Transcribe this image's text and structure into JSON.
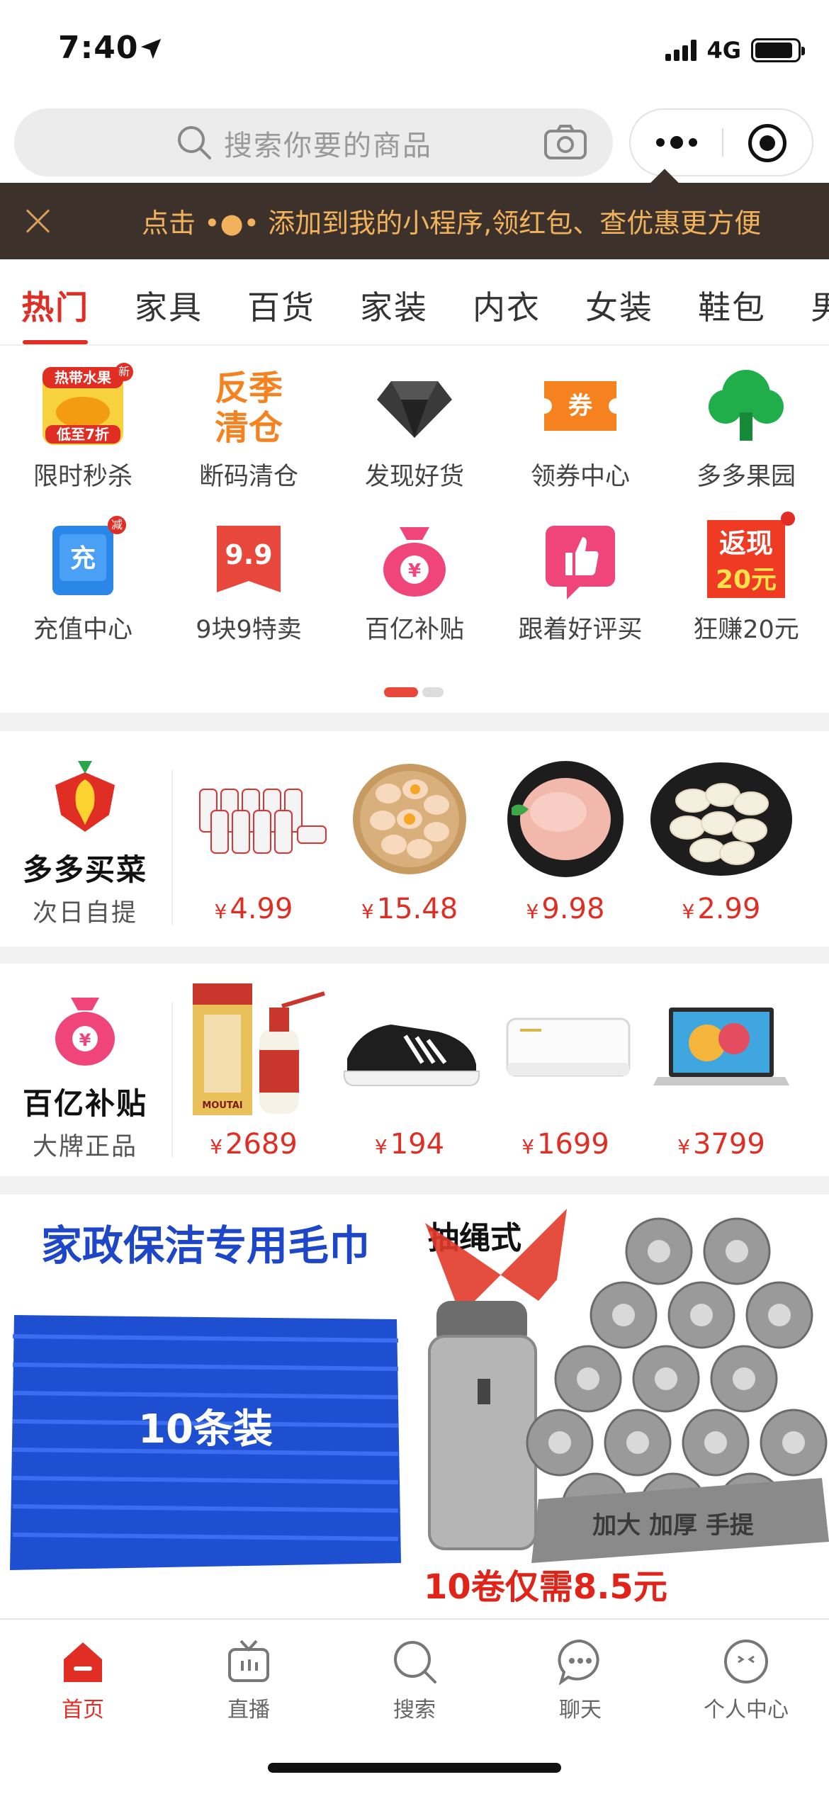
{
  "status_bar": {
    "time": "7:40",
    "network": "4G",
    "battery_level": 0.9
  },
  "search": {
    "placeholder": "搜索你要的商品"
  },
  "tip_banner": {
    "text": "点击 •●• 添加到我的小程序,领红包、查优惠更方便"
  },
  "tabs": [
    "热门",
    "家具",
    "百货",
    "家装",
    "内衣",
    "女装",
    "鞋包",
    "男"
  ],
  "active_tab": "热门",
  "quick_links": [
    {
      "label": "限时秒杀",
      "icon": "flash-sale-icon",
      "icon_text_top": "热带水果",
      "icon_text_bottom": "低至7折",
      "badge": "新"
    },
    {
      "label": "断码清仓",
      "icon": "clearance-icon",
      "icon_text_top": "反季",
      "icon_text_bottom": "清仓"
    },
    {
      "label": "发现好货",
      "icon": "diamond-icon"
    },
    {
      "label": "领券中心",
      "icon": "coupon-icon",
      "icon_text": "券"
    },
    {
      "label": "多多果园",
      "icon": "tree-icon"
    },
    {
      "label": "充值中心",
      "icon": "recharge-icon",
      "icon_text": "充",
      "badge": "减"
    },
    {
      "label": "9块9特卖",
      "icon": "nine-nine-icon",
      "icon_text": "9.9"
    },
    {
      "label": "百亿补贴",
      "icon": "money-bag-icon",
      "icon_text": "¥"
    },
    {
      "label": "跟着好评买",
      "icon": "thumbs-up-icon"
    },
    {
      "label": "狂赚20元",
      "icon": "cashback-icon",
      "icon_text_top": "返现",
      "icon_text_bottom": "20元"
    }
  ],
  "pager": {
    "count": 2,
    "active_index": 0
  },
  "grocery": {
    "title": "多多买菜",
    "subtitle": "次日自提",
    "products": [
      {
        "name": "yogurt-drinks",
        "currency": "¥",
        "price": "4.99"
      },
      {
        "name": "eggs",
        "currency": "¥",
        "price": "15.48"
      },
      {
        "name": "chicken-breast",
        "currency": "¥",
        "price": "9.98"
      },
      {
        "name": "dumplings",
        "currency": "¥",
        "price": "2.99"
      }
    ]
  },
  "subsidy": {
    "title": "百亿补贴",
    "subtitle": "大牌正品",
    "products": [
      {
        "name": "moutai-liquor",
        "currency": "¥",
        "price": "2689",
        "brand_text": "MOUTAI"
      },
      {
        "name": "sneaker",
        "currency": "¥",
        "price": "194"
      },
      {
        "name": "air-conditioner",
        "currency": "¥",
        "price": "1699"
      },
      {
        "name": "laptop",
        "currency": "¥",
        "price": "3799"
      }
    ]
  },
  "banners": [
    {
      "headline": "家政保洁专用毛巾",
      "overlay": "10条装"
    },
    {
      "headline": "抽绳式",
      "roll_text": "加大 加厚 手提",
      "footer": "10卷仅需8.5元"
    }
  ],
  "bottom_nav": [
    {
      "label": "首页",
      "icon": "home-icon",
      "active": true
    },
    {
      "label": "直播",
      "icon": "live-tv-icon"
    },
    {
      "label": "搜索",
      "icon": "search-icon"
    },
    {
      "label": "聊天",
      "icon": "chat-icon"
    },
    {
      "label": "个人中心",
      "icon": "profile-icon"
    }
  ],
  "colors": {
    "accent": "#e02e24",
    "tip_bg": "#3c312b",
    "tip_text": "#f2b25c"
  }
}
